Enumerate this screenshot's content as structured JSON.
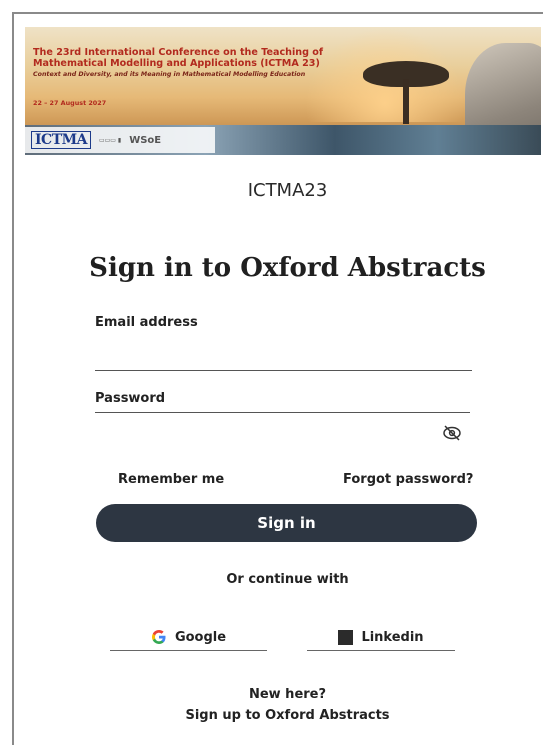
{
  "banner": {
    "title": "The 23rd International Conference on the Teaching of Mathematical Modelling and Applications (ICTMA 23)",
    "subtitle": "Context and Diversity, and its Meaning in Mathematical Modelling Education",
    "dates": "22 – 27 August 2027",
    "logo_ictma": "ICTMA",
    "logo_wsoe": "WSoE"
  },
  "conference_name": "ICTMA23",
  "page_title": "Sign in to Oxford Abstracts",
  "form": {
    "email_label": "Email address",
    "email_value": "",
    "password_label": "Password",
    "password_value": "",
    "remember_me": "Remember me",
    "forgot_password": "Forgot password?",
    "signin_label": "Sign in"
  },
  "social": {
    "or_text": "Or continue with",
    "google_label": "Google",
    "linkedin_label": "Linkedin"
  },
  "footer": {
    "new_here": "New here?",
    "signup_link": "Sign up to Oxford Abstracts"
  },
  "colors": {
    "signin_button_bg": "#2d3642",
    "banner_title": "#b22a1e"
  }
}
